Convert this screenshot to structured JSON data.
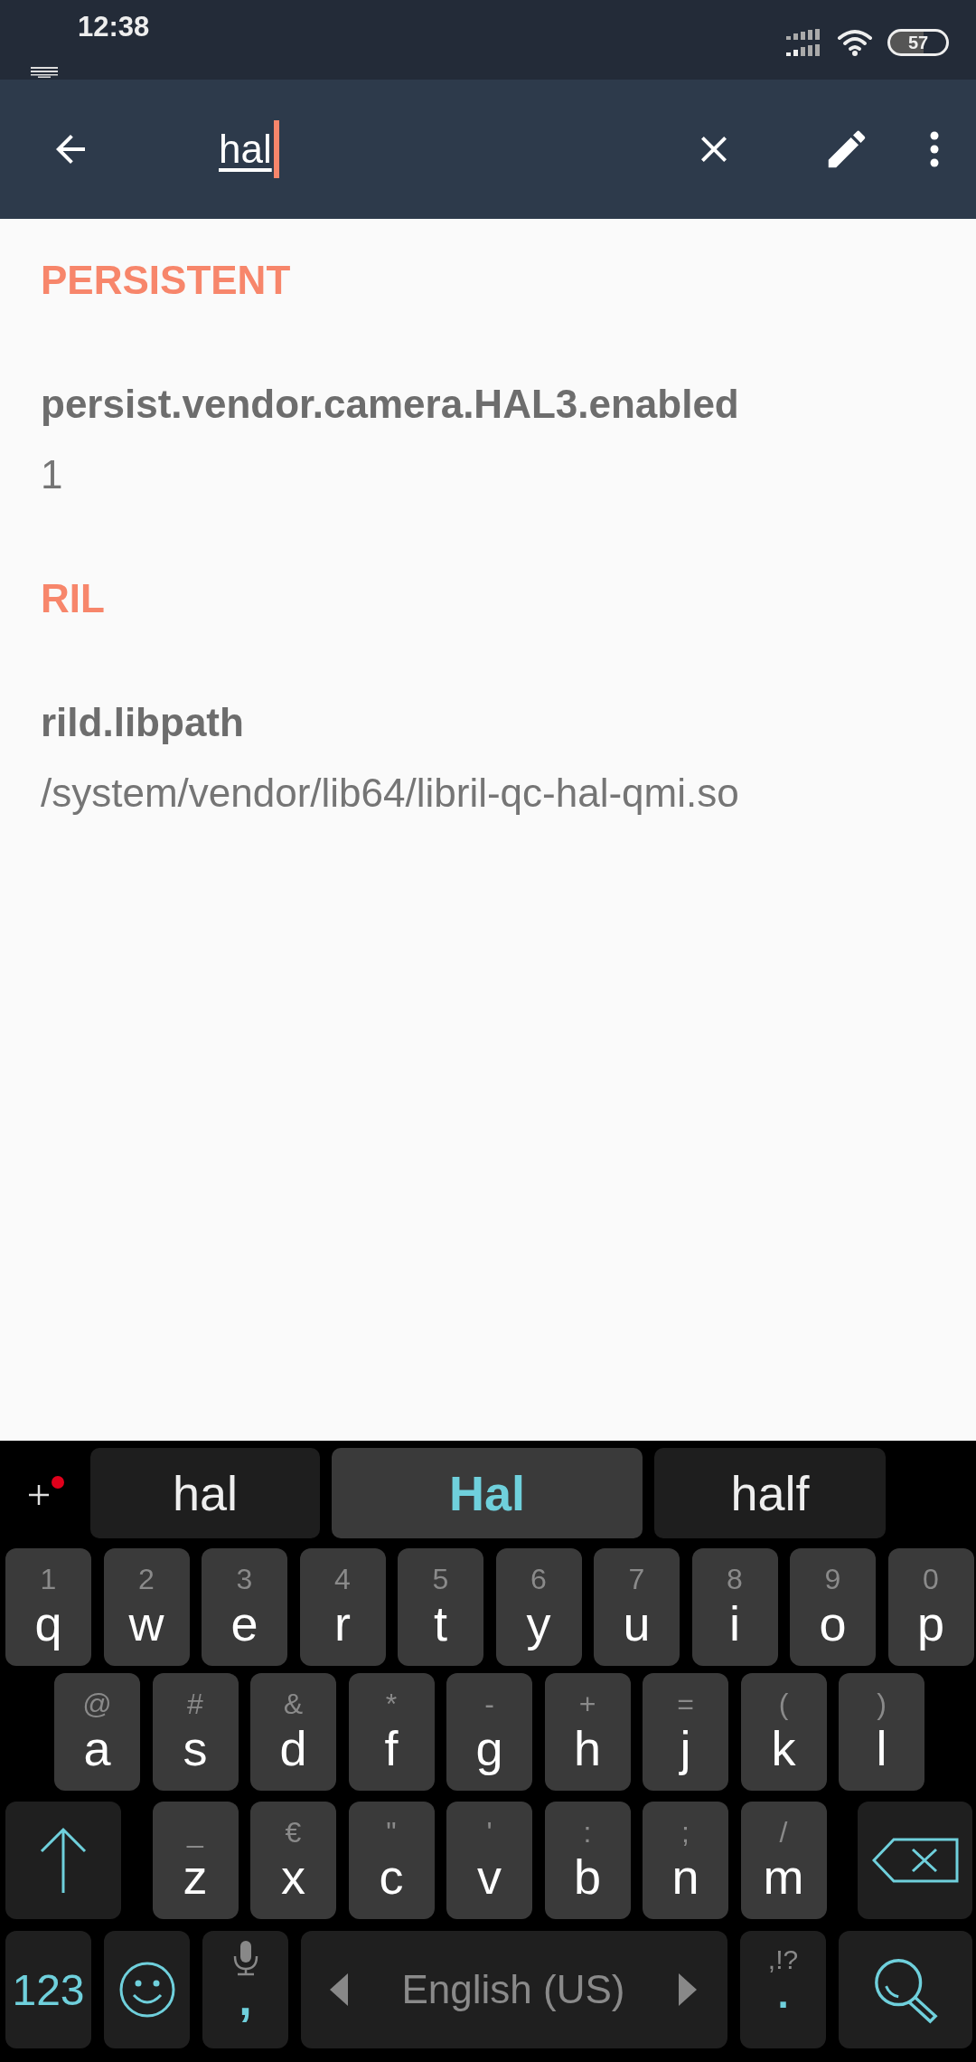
{
  "status_bar": {
    "time": "12:38",
    "battery": "57"
  },
  "app_bar": {
    "search_value": "hal"
  },
  "sections": [
    {
      "title": "PERSISTENT",
      "items": [
        {
          "name": "persist.vendor.camera.HAL3.enabled",
          "value": "1"
        }
      ]
    },
    {
      "title": "RIL",
      "items": [
        {
          "name": "rild.libpath",
          "value": "/system/vendor/lib64/libril-qc-hal-qmi.so"
        }
      ]
    }
  ],
  "keyboard": {
    "suggestions": [
      {
        "text": "hal",
        "selected": false
      },
      {
        "text": "Hal",
        "selected": true
      },
      {
        "text": "half",
        "selected": false
      }
    ],
    "rows": [
      {
        "keys": [
          {
            "kind": "char",
            "hint": "1",
            "label": "q"
          },
          {
            "kind": "char",
            "hint": "2",
            "label": "w"
          },
          {
            "kind": "char",
            "hint": "3",
            "label": "e"
          },
          {
            "kind": "char",
            "hint": "4",
            "label": "r"
          },
          {
            "kind": "char",
            "hint": "5",
            "label": "t"
          },
          {
            "kind": "char",
            "hint": "6",
            "label": "y"
          },
          {
            "kind": "char",
            "hint": "7",
            "label": "u"
          },
          {
            "kind": "char",
            "hint": "8",
            "label": "i"
          },
          {
            "kind": "char",
            "hint": "9",
            "label": "o"
          },
          {
            "kind": "char",
            "hint": "0",
            "label": "p"
          }
        ]
      },
      {
        "keys": [
          {
            "kind": "char",
            "hint": "@",
            "label": "a"
          },
          {
            "kind": "char",
            "hint": "#",
            "label": "s"
          },
          {
            "kind": "char",
            "hint": "&",
            "label": "d"
          },
          {
            "kind": "char",
            "hint": "*",
            "label": "f"
          },
          {
            "kind": "char",
            "hint": "-",
            "label": "g"
          },
          {
            "kind": "char",
            "hint": "+",
            "label": "h"
          },
          {
            "kind": "char",
            "hint": "=",
            "label": "j"
          },
          {
            "kind": "char",
            "hint": "(",
            "label": "k"
          },
          {
            "kind": "char",
            "hint": ")",
            "label": "l"
          }
        ]
      },
      {
        "keys": [
          {
            "kind": "shift"
          },
          {
            "kind": "char",
            "hint": "_",
            "label": "z"
          },
          {
            "kind": "char",
            "hint": "€",
            "label": "x"
          },
          {
            "kind": "char",
            "hint": "\"",
            "label": "c"
          },
          {
            "kind": "char",
            "hint": "'",
            "label": "v"
          },
          {
            "kind": "char",
            "hint": ":",
            "label": "b"
          },
          {
            "kind": "char",
            "hint": ";",
            "label": "n"
          },
          {
            "kind": "char",
            "hint": "/",
            "label": "m"
          },
          {
            "kind": "backspace"
          }
        ]
      },
      {
        "keys": [
          {
            "kind": "symbols",
            "label": "123"
          },
          {
            "kind": "emoji"
          },
          {
            "kind": "voice_comma",
            "label": ","
          },
          {
            "kind": "space",
            "label": "English (US)"
          },
          {
            "kind": "period",
            "hint": ",!?",
            "label": "."
          },
          {
            "kind": "search"
          }
        ]
      }
    ]
  }
}
